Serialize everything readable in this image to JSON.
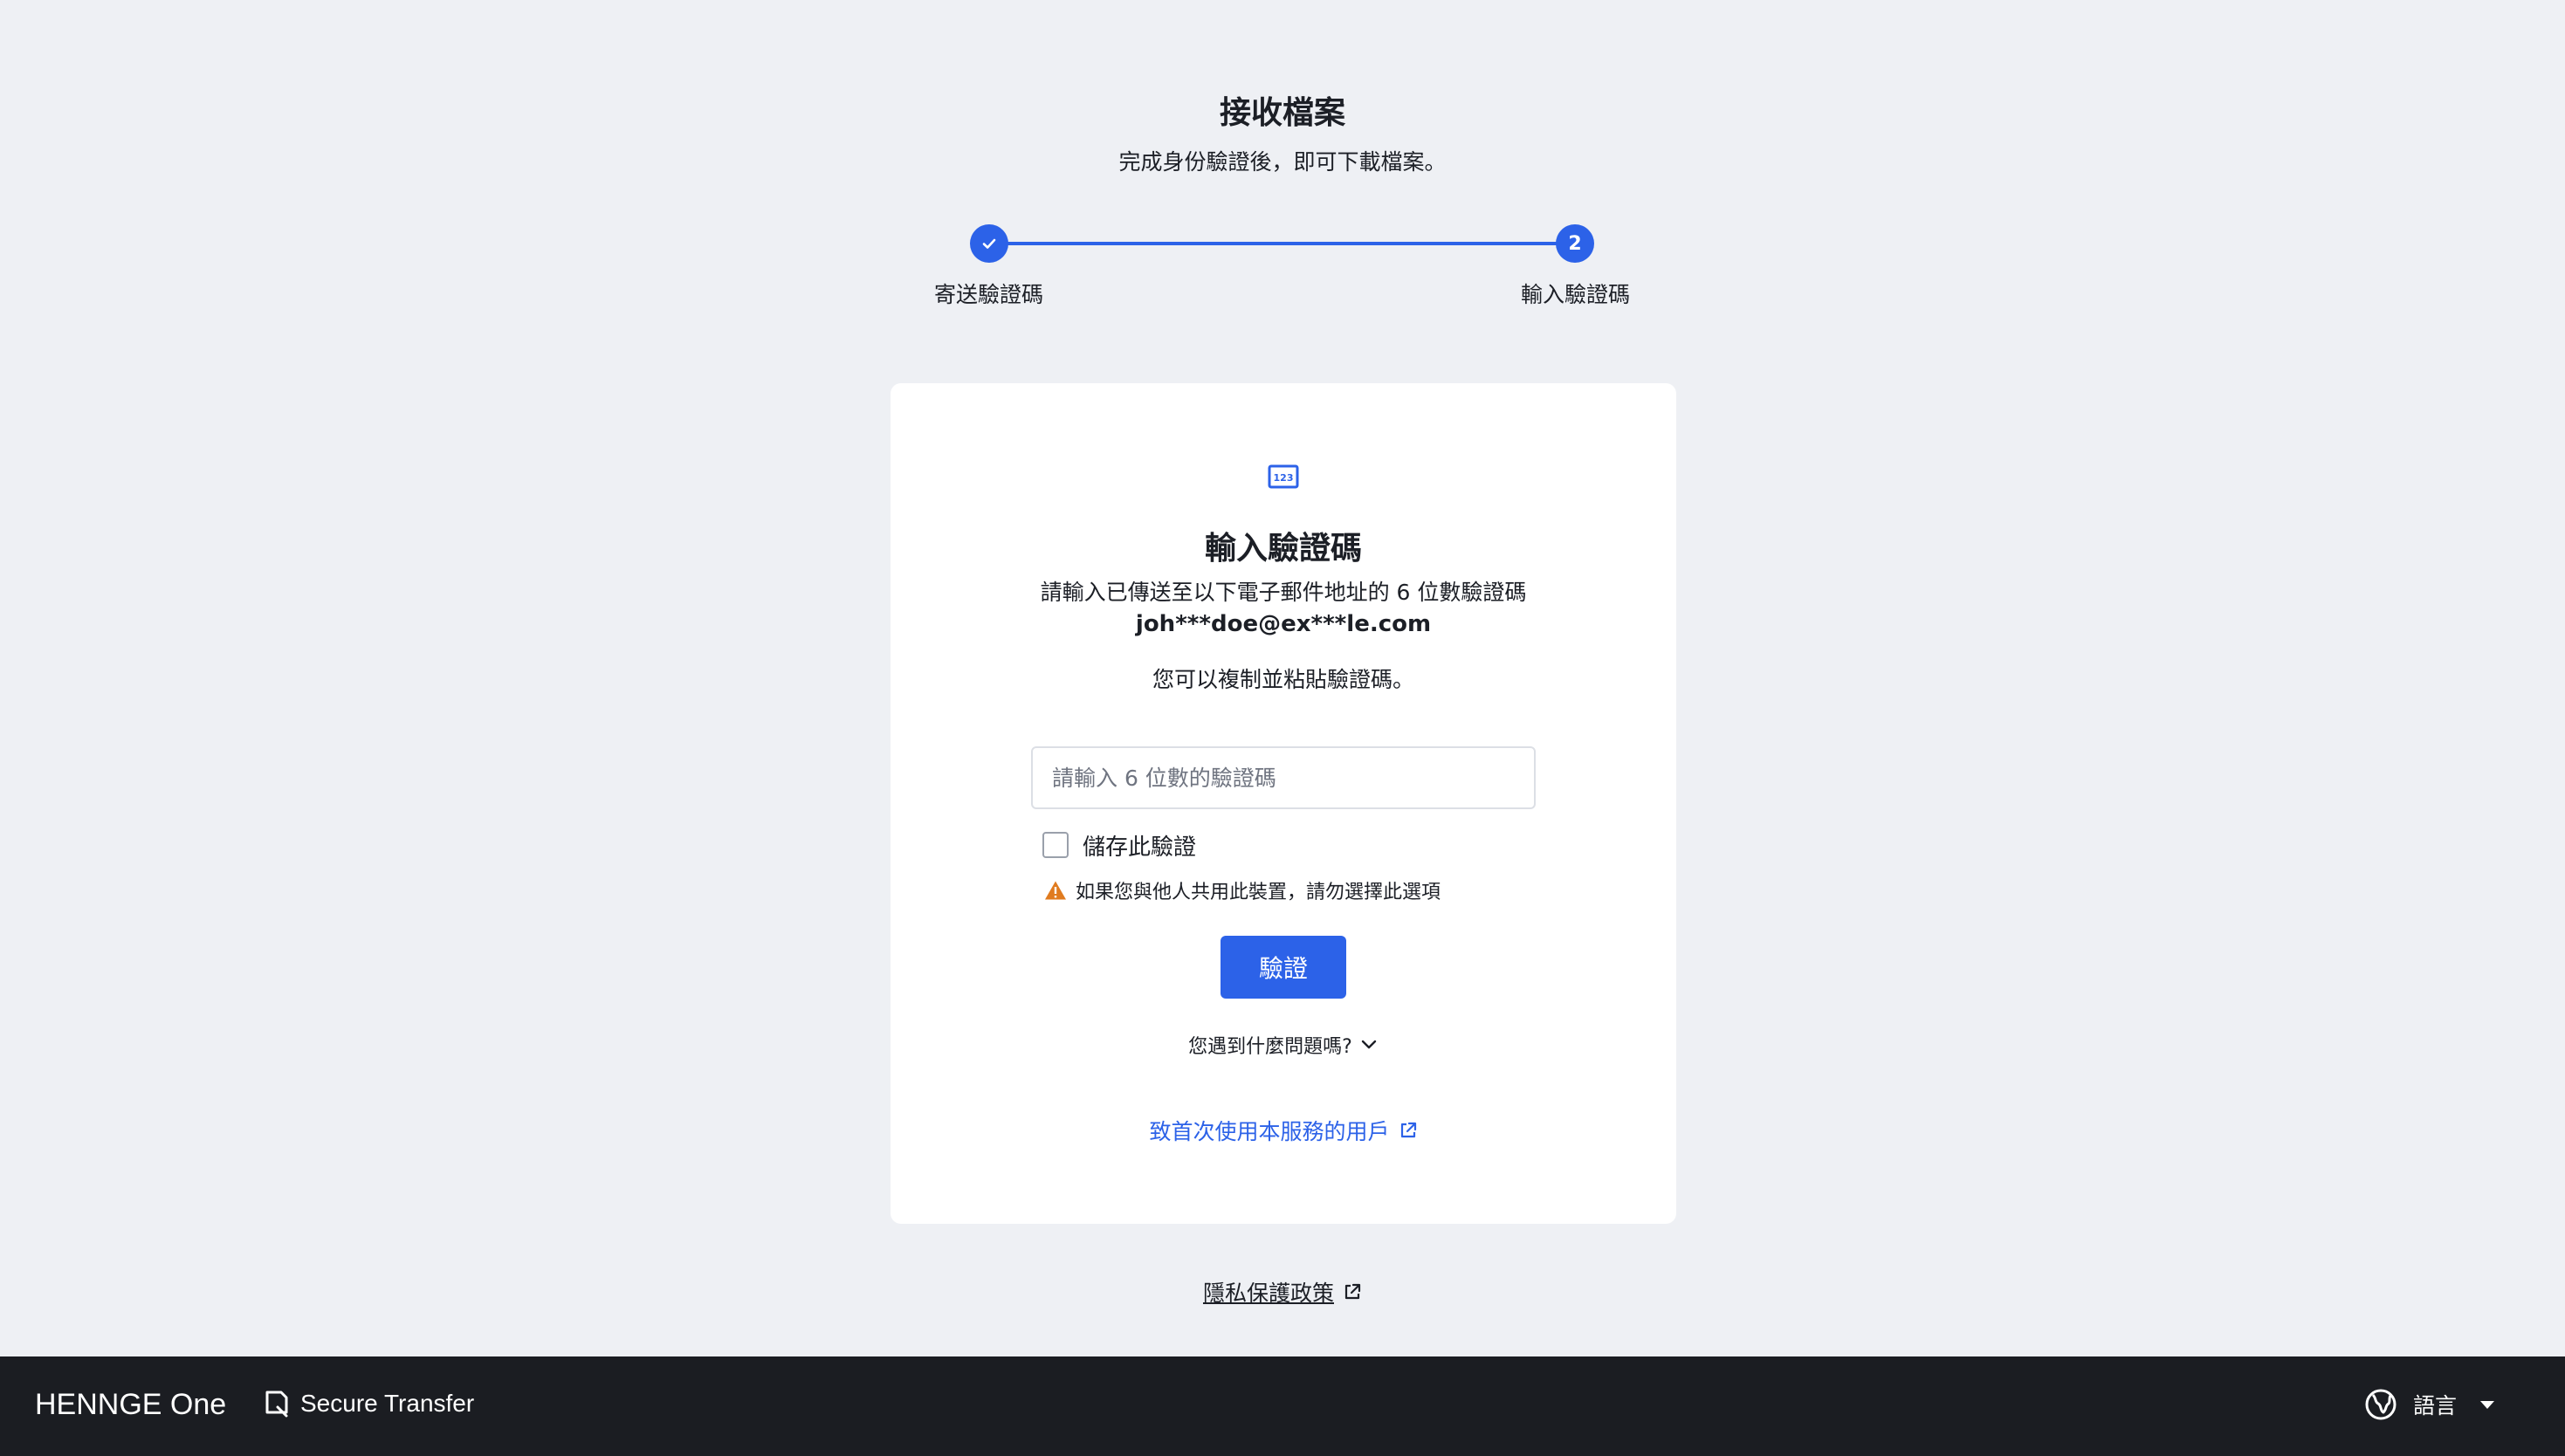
{
  "page": {
    "title": "接收檔案",
    "subtitle": "完成身份驗證後，即可下載檔案。"
  },
  "stepper": {
    "steps": [
      {
        "label": "寄送驗證碼",
        "state": "completed",
        "marker": "✓"
      },
      {
        "label": "輸入驗證碼",
        "state": "current",
        "marker": "2"
      }
    ]
  },
  "card": {
    "icon": "numeric-code-icon",
    "title": "輸入驗證碼",
    "description": "請輸入已傳送至以下電子郵件地址的 6 位數驗證碼",
    "email": "joh***doe@ex***le.com",
    "copy_hint": "您可以複制並粘貼驗證碼。",
    "code_input": {
      "placeholder": "請輸入 6 位數的驗證碼",
      "value": ""
    },
    "remember": {
      "label": "儲存此驗證",
      "checked": false
    },
    "warning": "如果您與他人共用此裝置，請勿選擇此選項",
    "verify_button": "驗證",
    "problem_toggle": "您遇到什麼問題嗎?",
    "first_time_link": "致首次使用本服務的用戶"
  },
  "privacy_link": "隱私保護政策",
  "footer": {
    "brand": "HENNGE One",
    "product": "Secure Transfer",
    "language_label": "語言"
  },
  "colors": {
    "accent": "#2c62e8",
    "background": "#eef0f4",
    "footer": "#1b1d22",
    "warning": "#e07b1f"
  }
}
